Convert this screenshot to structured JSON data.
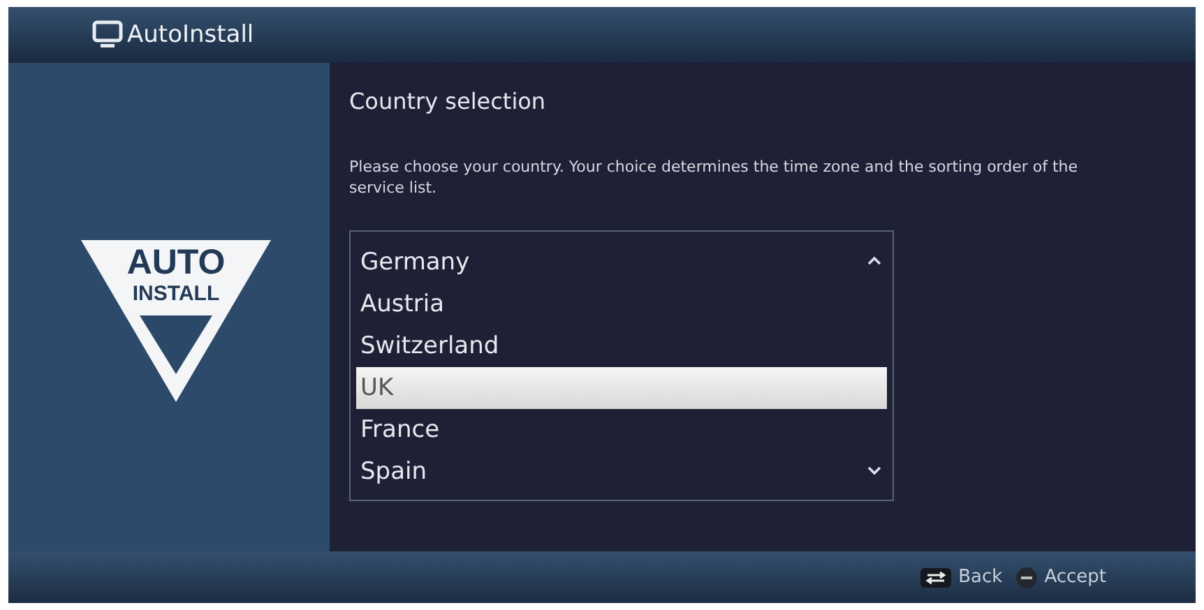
{
  "window": {
    "title": "AutoInstall"
  },
  "logo": {
    "line_1": "AUTO",
    "line_2": "INSTALL"
  },
  "heading": "Country selection",
  "description": "Please choose your country. Your choice determines the time zone and the sorting order of the service list.",
  "countries": [
    {
      "label": "Germany",
      "selected": false
    },
    {
      "label": "Austria",
      "selected": false
    },
    {
      "label": "Switzerland",
      "selected": false
    },
    {
      "label": "UK",
      "selected": true
    },
    {
      "label": "France",
      "selected": false
    },
    {
      "label": "Spain",
      "selected": false
    }
  ],
  "footer": {
    "hints": [
      {
        "kind": "swap",
        "label": "Back"
      },
      {
        "kind": "ok",
        "label": "Accept"
      }
    ]
  }
}
